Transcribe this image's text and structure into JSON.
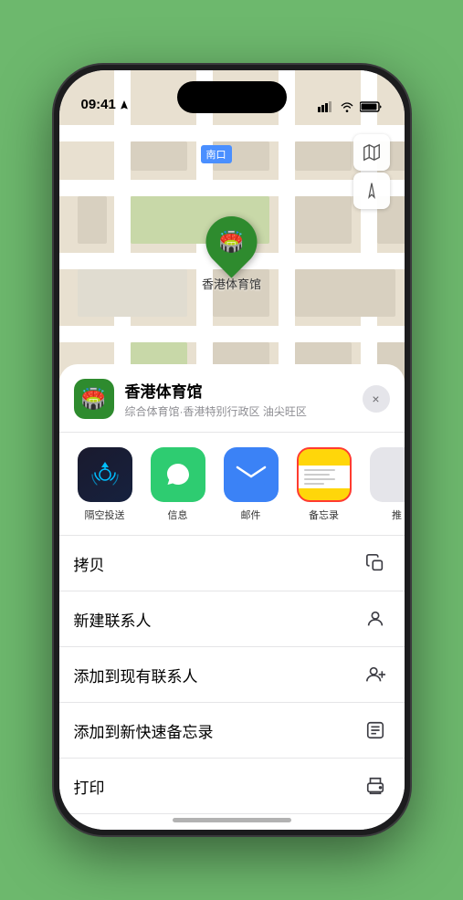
{
  "status_bar": {
    "time": "09:41",
    "location_arrow": true
  },
  "map": {
    "tag_text": "南口",
    "marker_label": "香港体育馆",
    "marker_emoji": "🏟️"
  },
  "location_card": {
    "name": "香港体育馆",
    "subtitle": "综合体育馆·香港特别行政区 油尖旺区",
    "close_label": "×"
  },
  "share_apps": [
    {
      "id": "airdrop",
      "label": "隔空投送",
      "selected": false
    },
    {
      "id": "messages",
      "label": "信息",
      "selected": false
    },
    {
      "id": "mail",
      "label": "邮件",
      "selected": false
    },
    {
      "id": "notes",
      "label": "备忘录",
      "selected": true
    },
    {
      "id": "more",
      "label": "推",
      "selected": false
    }
  ],
  "actions": [
    {
      "id": "copy",
      "label": "拷贝",
      "icon": "copy"
    },
    {
      "id": "new-contact",
      "label": "新建联系人",
      "icon": "person"
    },
    {
      "id": "add-contact",
      "label": "添加到现有联系人",
      "icon": "person-add"
    },
    {
      "id": "quick-note",
      "label": "添加到新快速备忘录",
      "icon": "note"
    },
    {
      "id": "print",
      "label": "打印",
      "icon": "print"
    }
  ]
}
